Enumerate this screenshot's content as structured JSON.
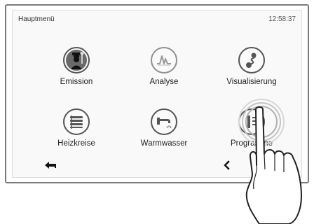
{
  "header": {
    "title": "Hauptmenü",
    "time": "12:58:37"
  },
  "menu": {
    "items": [
      {
        "label": "Emission",
        "icon": "chimney-sweep-icon"
      },
      {
        "label": "Analyse",
        "icon": "waveform-icon"
      },
      {
        "label": "Visualisierung",
        "icon": "flow-diagram-icon"
      },
      {
        "label": "Heizkreise",
        "icon": "radiator-icon"
      },
      {
        "label": "Warmwasser",
        "icon": "faucet-icon"
      },
      {
        "label": "Programme",
        "icon": "program-list-icon"
      }
    ]
  },
  "navigation": {
    "back_icon": "back-arrow-icon",
    "prev_icon": "chevron-left-icon"
  },
  "colors": {
    "frame": "#7a7a7a",
    "screen": "#f9f9f9",
    "icon_dark": "#555555",
    "icon_light": "#8f8f8f",
    "text": "#222222"
  }
}
